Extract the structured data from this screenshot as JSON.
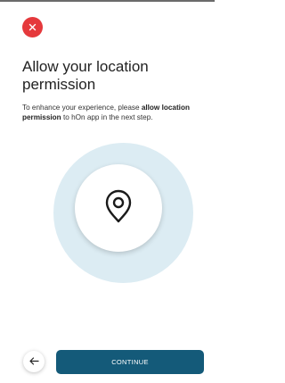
{
  "colors": {
    "close": "#e5393c",
    "primary": "#145a79",
    "halo": "#dcecf3"
  },
  "icons": {
    "close": "close-icon",
    "location": "location-pin-icon",
    "back": "arrow-left-icon"
  },
  "title": "Allow your location permission",
  "body": {
    "prefix": "To enhance your experience, please ",
    "bold": "allow location permission",
    "suffix": " to hOn app in the next step."
  },
  "actions": {
    "continue_label": "CONTINUE"
  }
}
